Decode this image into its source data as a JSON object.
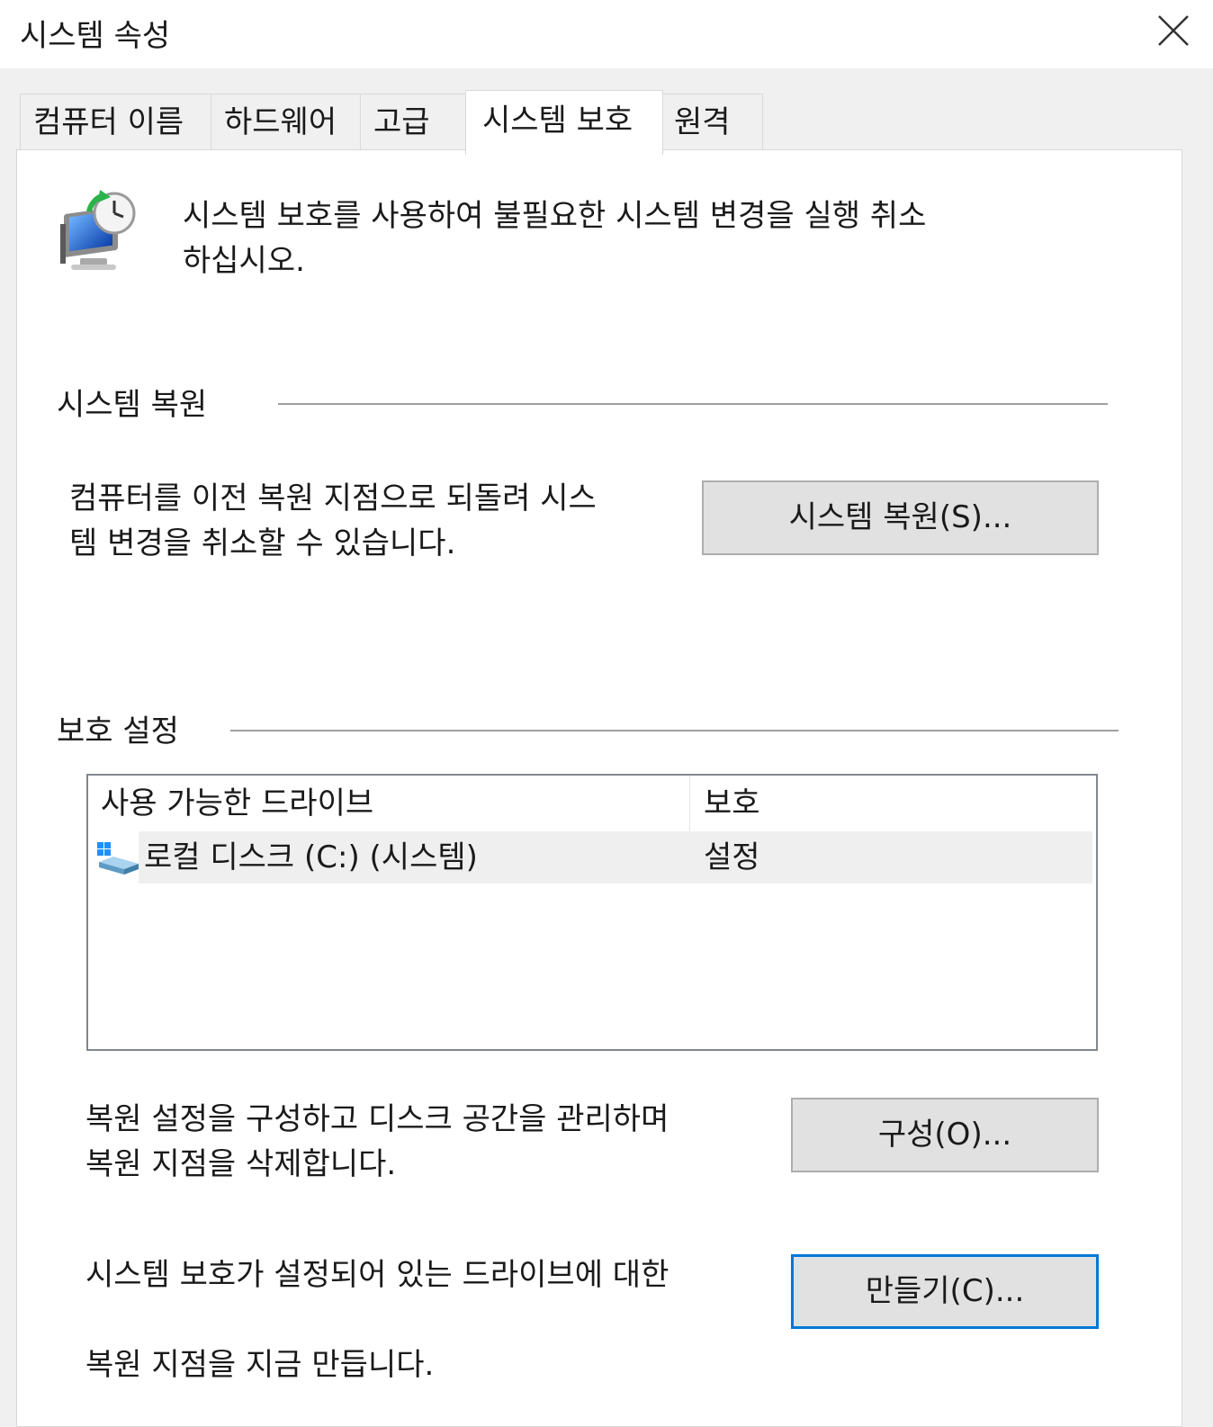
{
  "window": {
    "title": "시스템 속성"
  },
  "tabs": [
    {
      "label": "컴퓨터 이름"
    },
    {
      "label": "하드웨어"
    },
    {
      "label": "고급"
    },
    {
      "label": "시스템 보호"
    },
    {
      "label": "원격"
    }
  ],
  "active_tab": "시스템 보호",
  "intro": {
    "line1": "시스템 보호를 사용하여 불필요한 시스템 변경을 실행 취소",
    "line2": "하십시오."
  },
  "restore_section": {
    "heading": "시스템 복원",
    "desc_line1": "컴퓨터를 이전 복원 지점으로 되돌려 시스",
    "desc_line2": "템 변경을 취소할 수 있습니다.",
    "button": "시스템 복원(S)..."
  },
  "protection_section": {
    "heading": "보호 설정",
    "columns": [
      "사용 가능한 드라이브",
      "보호"
    ],
    "drives": [
      {
        "name": "로컬 디스크 (C:) (시스템)",
        "protection": "설정"
      }
    ],
    "config_desc_line1": "복원 설정을 구성하고 디스크 공간을 관리하며",
    "config_desc_line2": "복원 지점을 삭제합니다.",
    "config_button": "구성(O)...",
    "create_desc_line1": "시스템 보호가 설정되어 있는 드라이브에 대한",
    "create_desc_line2": "복원 지점을 지금 만듭니다.",
    "create_button": "만들기(C)..."
  },
  "colors": {
    "default_button_border": "#0078d7",
    "button_face": "#e1e1e1",
    "panel_bg": "#ffffff",
    "chrome_bg": "#f0f0f0"
  }
}
